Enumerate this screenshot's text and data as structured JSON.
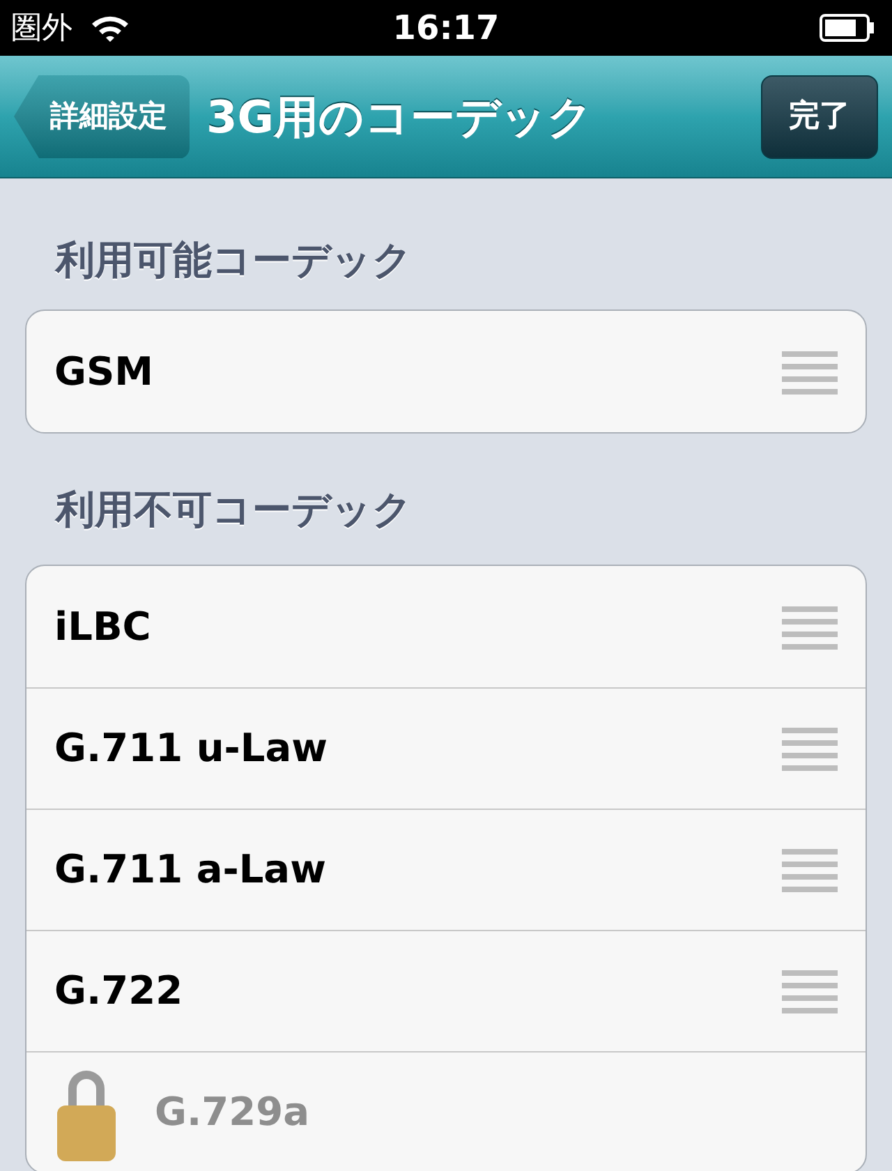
{
  "status_bar": {
    "carrier": "圏外",
    "time": "16:17"
  },
  "nav_bar": {
    "back": "詳細設定",
    "title": "3G用のコーデック",
    "done": "完了"
  },
  "sections": [
    {
      "header": "利用可能コーデック",
      "rows": [
        {
          "label": "GSM",
          "disabled": false
        }
      ]
    },
    {
      "header": "利用不可コーデック",
      "rows": [
        {
          "label": "iLBC",
          "disabled": false
        },
        {
          "label": "G.711 u-Law",
          "disabled": false
        },
        {
          "label": "G.711 a-Law",
          "disabled": false
        },
        {
          "label": "G.722",
          "disabled": false
        },
        {
          "label": "G.729a",
          "disabled": true
        }
      ]
    }
  ]
}
